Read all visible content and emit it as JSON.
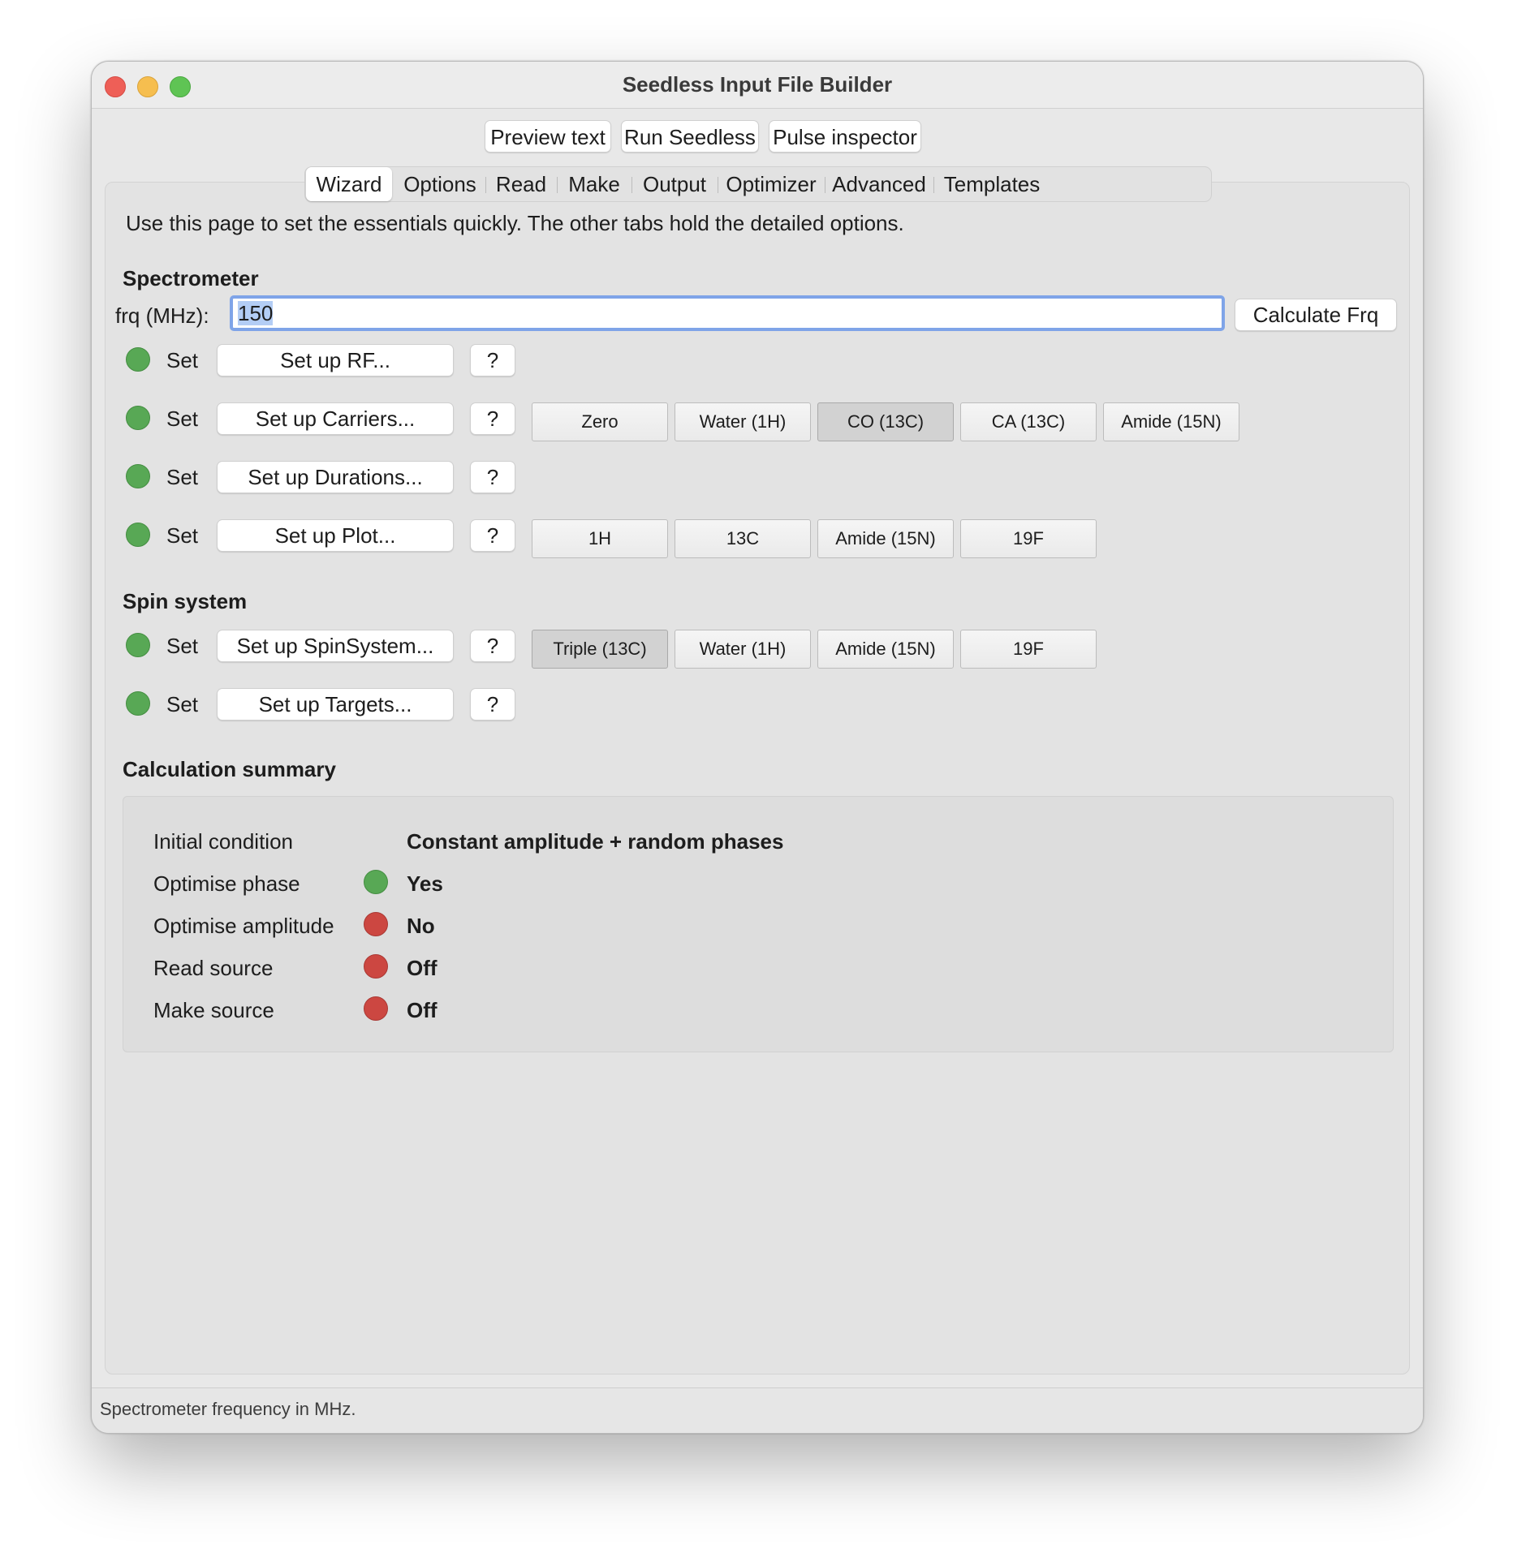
{
  "window": {
    "title": "Seedless Input File Builder"
  },
  "toolbar": {
    "preview_label": "Preview text",
    "run_label": "Run Seedless",
    "inspector_label": "Pulse inspector"
  },
  "tabs": [
    {
      "label": "Wizard",
      "active": true
    },
    {
      "label": "Options"
    },
    {
      "label": "Read"
    },
    {
      "label": "Make"
    },
    {
      "label": "Output"
    },
    {
      "label": "Optimizer"
    },
    {
      "label": "Advanced"
    },
    {
      "label": "Templates"
    }
  ],
  "wizard": {
    "intro": "Use this page to set the essentials quickly. The other tabs hold the detailed options.",
    "spectrometer": {
      "heading": "Spectrometer",
      "frq_label": "frq (MHz):",
      "frq_value": "150",
      "calc_label": "Calculate Frq"
    },
    "rows": [
      {
        "status": "Set",
        "button": "Set up RF...",
        "help": "?"
      },
      {
        "status": "Set",
        "button": "Set up Carriers...",
        "help": "?",
        "presets": [
          "Zero",
          "Water (1H)",
          "CO (13C)",
          "CA (13C)",
          "Amide (15N)"
        ],
        "selected": "CO (13C)"
      },
      {
        "status": "Set",
        "button": "Set up Durations...",
        "help": "?"
      },
      {
        "status": "Set",
        "button": "Set up Plot...",
        "help": "?",
        "presets": [
          "1H",
          "13C",
          "Amide (15N)",
          "19F"
        ]
      }
    ],
    "spin": {
      "heading": "Spin system",
      "rows": [
        {
          "status": "Set",
          "button": "Set up SpinSystem...",
          "help": "?",
          "presets": [
            "Triple (13C)",
            "Water (1H)",
            "Amide (15N)",
            "19F"
          ],
          "selected": "Triple (13C)"
        },
        {
          "status": "Set",
          "button": "Set up Targets...",
          "help": "?"
        }
      ]
    },
    "summary": {
      "heading": "Calculation summary",
      "items": [
        {
          "label": "Initial condition",
          "value": "Constant amplitude + random phases"
        },
        {
          "label": "Optimise phase",
          "value": "Yes",
          "indicator": "green"
        },
        {
          "label": "Optimise amplitude",
          "value": "No",
          "indicator": "red"
        },
        {
          "label": "Read source",
          "value": "Off",
          "indicator": "red"
        },
        {
          "label": "Make source",
          "value": "Off",
          "indicator": "red"
        }
      ]
    }
  },
  "colors": {
    "indicator_green": "#58a855",
    "indicator_red": "#cc4741",
    "focus_ring": "#7fa4e8"
  },
  "status_bar": {
    "text": "Spectrometer frequency in MHz."
  }
}
